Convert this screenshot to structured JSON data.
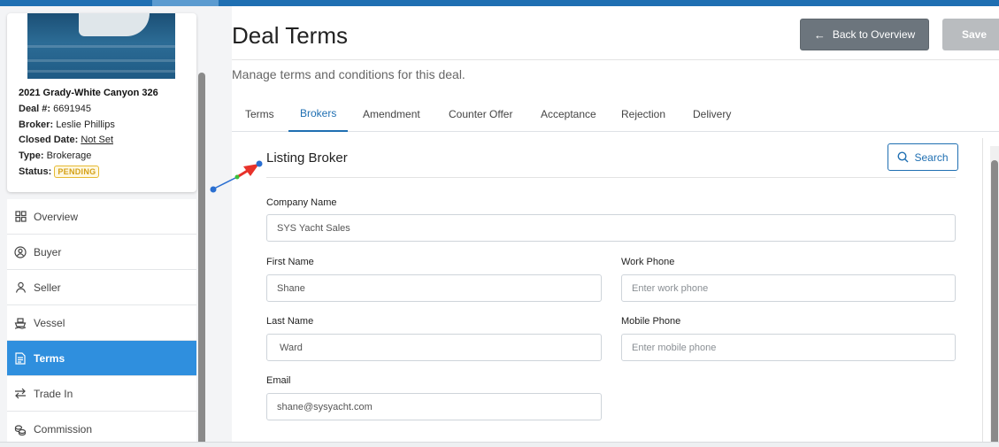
{
  "deal": {
    "boat_name": "2021 Grady-White Canyon 326",
    "deal_no_label": "Deal #:",
    "deal_no": "6691945",
    "broker_label": "Broker:",
    "broker": "Leslie Phillips",
    "closed_label": "Closed Date:",
    "closed": "Not Set",
    "type_label": "Type:",
    "type": "Brokerage",
    "status_label": "Status:",
    "status": "PENDING",
    "status_color": "#d4a017"
  },
  "nav": {
    "items": [
      {
        "label": "Overview",
        "icon": "grid-icon"
      },
      {
        "label": "Buyer",
        "icon": "user-circle-icon"
      },
      {
        "label": "Seller",
        "icon": "user-icon"
      },
      {
        "label": "Vessel",
        "icon": "ship-icon"
      },
      {
        "label": "Terms",
        "icon": "document-icon"
      },
      {
        "label": "Trade In",
        "icon": "swap-icon"
      },
      {
        "label": "Commission",
        "icon": "coins-icon"
      }
    ],
    "active_color": "#2f8fde"
  },
  "header": {
    "title": "Deal Terms",
    "subtitle": "Manage terms and conditions for this deal.",
    "back_label": "Back to Overview",
    "save_label": "Save"
  },
  "tabs": [
    "Terms",
    "Brokers",
    "Amendment",
    "Counter Offer",
    "Acceptance",
    "Rejection",
    "Delivery"
  ],
  "listing_broker": {
    "title": "Listing Broker",
    "search_label": "Search",
    "company_label": "Company Name",
    "company_value": "SYS Yacht Sales",
    "first_label": "First Name",
    "first_value": "Shane",
    "last_label": "Last Name",
    "last_value": "Ward",
    "email_label": "Email",
    "email_value": "shane@sysyacht.com",
    "work_label": "Work Phone",
    "work_placeholder": "Enter work phone",
    "mobile_label": "Mobile Phone",
    "mobile_placeholder": "Enter mobile phone"
  },
  "colors": {
    "accent": "#1f6fb2",
    "annotation_arrow": "#e8322b",
    "annotation_dot": "#2a6fd1"
  }
}
